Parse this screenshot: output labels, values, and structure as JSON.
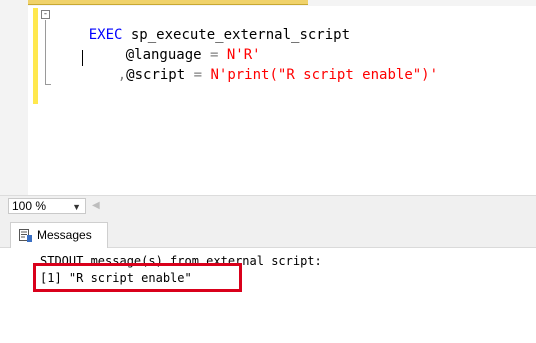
{
  "editor": {
    "collapse_glyph": "⊟",
    "lines": [
      {
        "parts": [
          {
            "text": "EXEC",
            "kind": "keyword"
          },
          {
            "text": " sp_execute_external_script",
            "kind": "plain"
          }
        ]
      },
      {
        "parts": [
          {
            "text": "@language",
            "kind": "plain"
          },
          {
            "text": " = ",
            "kind": "operator"
          },
          {
            "text": "N'R'",
            "kind": "string"
          }
        ]
      },
      {
        "parts": [
          {
            "text": ",",
            "kind": "operator"
          },
          {
            "text": "@script",
            "kind": "plain"
          },
          {
            "text": " = ",
            "kind": "operator"
          },
          {
            "text": "N'print(\"R script enable\")'",
            "kind": "string"
          }
        ]
      }
    ],
    "colors": {
      "keyword": "#0000ff",
      "plain": "#000000",
      "operator": "#808080",
      "string": "#ff0000",
      "change_bar": "#ffe84d"
    }
  },
  "zoom": {
    "value": "100 %",
    "dropdown_icon": "triangle-down",
    "scroll_left_icon": "triangle-left"
  },
  "results": {
    "tab_label": "Messages",
    "tab_icon": "messages-icon",
    "lines": [
      "STDOUT message(s) from external script:",
      "[1] \"R script enable\""
    ],
    "highlight_color": "#d9001b"
  }
}
